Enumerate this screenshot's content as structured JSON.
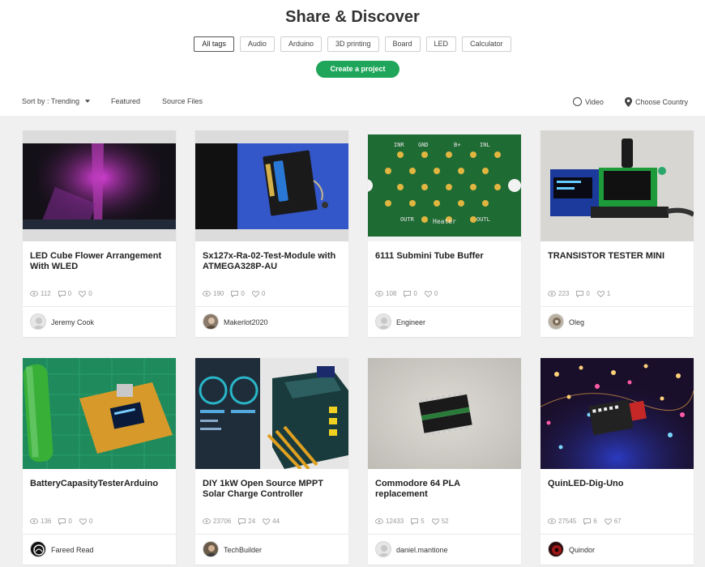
{
  "header": {
    "title": "Share & Discover",
    "create_label": "Create a project"
  },
  "tags": [
    "All tags",
    "Audio",
    "Arduino",
    "3D printing",
    "Board",
    "LED",
    "Calculator"
  ],
  "toolbar": {
    "sort_label": "Sort by : Trending",
    "featured_label": "Featured",
    "source_files_label": "Source Files",
    "video_label": "Video",
    "country_label": "Choose Country"
  },
  "projects": [
    {
      "title": "LED Cube Flower Arrangement With WLED",
      "views": "112",
      "comments": "0",
      "likes": "0",
      "author": "Jeremy Cook"
    },
    {
      "title": "Sx127x-Ra-02-Test-Module with ATMEGA328P-AU",
      "views": "190",
      "comments": "0",
      "likes": "0",
      "author": "Makerlot2020"
    },
    {
      "title": "6111 Submini Tube Buffer",
      "views": "108",
      "comments": "0",
      "likes": "0",
      "author": "Engineer"
    },
    {
      "title": "TRANSISTOR TESTER MINI",
      "views": "223",
      "comments": "0",
      "likes": "1",
      "author": "Oleg"
    },
    {
      "title": "BatteryCapasityTesterArduino",
      "views": "136",
      "comments": "0",
      "likes": "0",
      "author": "Fareed Read"
    },
    {
      "title": "DIY 1kW Open Source MPPT Solar Charge Controller",
      "views": "23706",
      "comments": "24",
      "likes": "44",
      "author": "TechBuilder"
    },
    {
      "title": "Commodore 64 PLA replacement",
      "views": "12433",
      "comments": "5",
      "likes": "52",
      "author": "daniel.mantione"
    },
    {
      "title": "QuinLED-Dig-Uno",
      "views": "27545",
      "comments": "6",
      "likes": "67",
      "author": "Quindor"
    }
  ],
  "pcb_labels": {
    "inr": "INR",
    "gnd": "GND",
    "bplus": "B+",
    "inl": "INL",
    "outr": "OUTR",
    "heater": "Heater",
    "outl": "OUTL"
  },
  "colors": {
    "accent": "#1fa65a",
    "grid_bg": "#f0f0f0"
  }
}
